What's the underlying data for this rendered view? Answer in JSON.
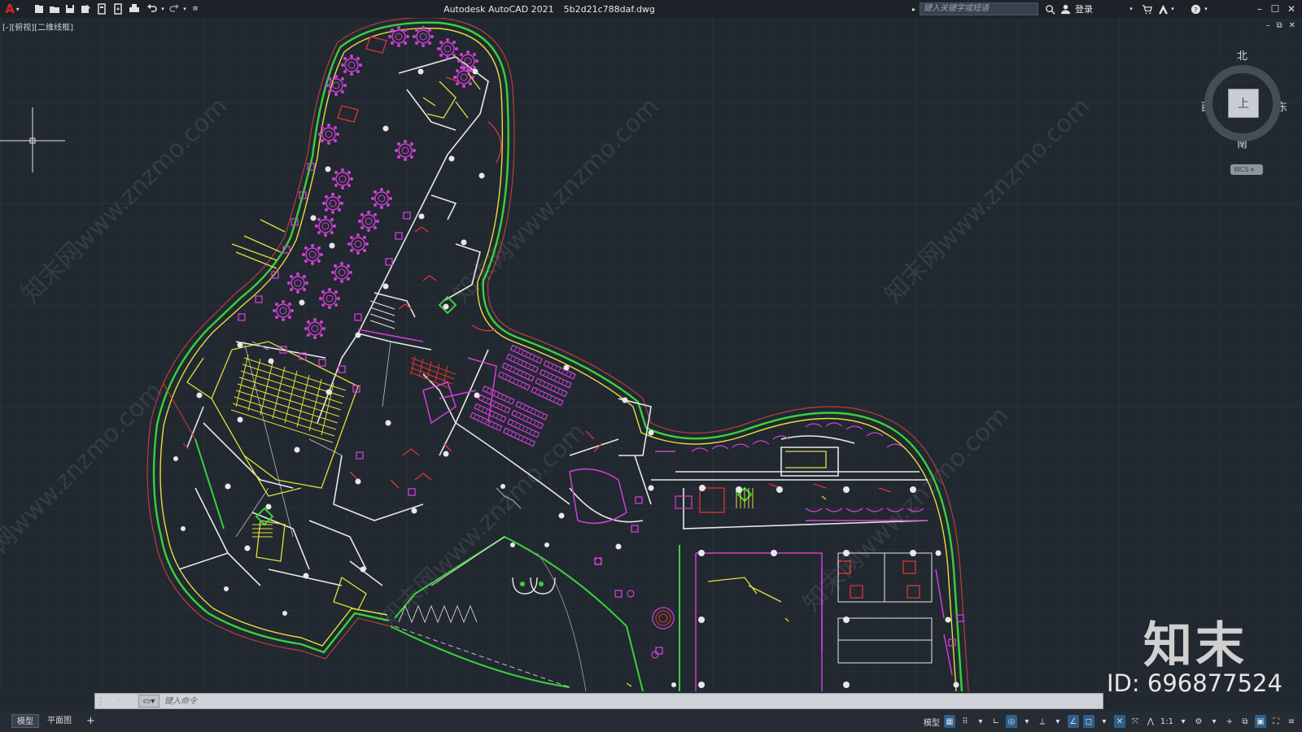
{
  "titlebar": {
    "app": "Autodesk AutoCAD 2021",
    "file": "5b2d21c788daf.dwg",
    "search_placeholder": "键入关键字或短语",
    "login": "登录"
  },
  "viewport": {
    "label": "[-][俯视][二维线框]"
  },
  "viewcube": {
    "north": "北",
    "south": "南",
    "west": "西",
    "east": "东",
    "face": "上",
    "wcs": "WCS"
  },
  "watermark": {
    "text": "知末网www.znzmo.com",
    "brand": "知末",
    "id": "ID: 696877524"
  },
  "command": {
    "placeholder": "键入命令"
  },
  "status": {
    "tab_model": "模型",
    "tab_layout": "平面图",
    "tab_add": "+",
    "model_btn": "模型",
    "scale": "1:1"
  },
  "colors": {
    "background": "#212830",
    "wall_green": "#39d13a",
    "wall_yellow": "#e4e03a",
    "furniture_magenta": "#d33fd6",
    "door_red": "#e03535",
    "line_white": "#e8e8e8"
  }
}
